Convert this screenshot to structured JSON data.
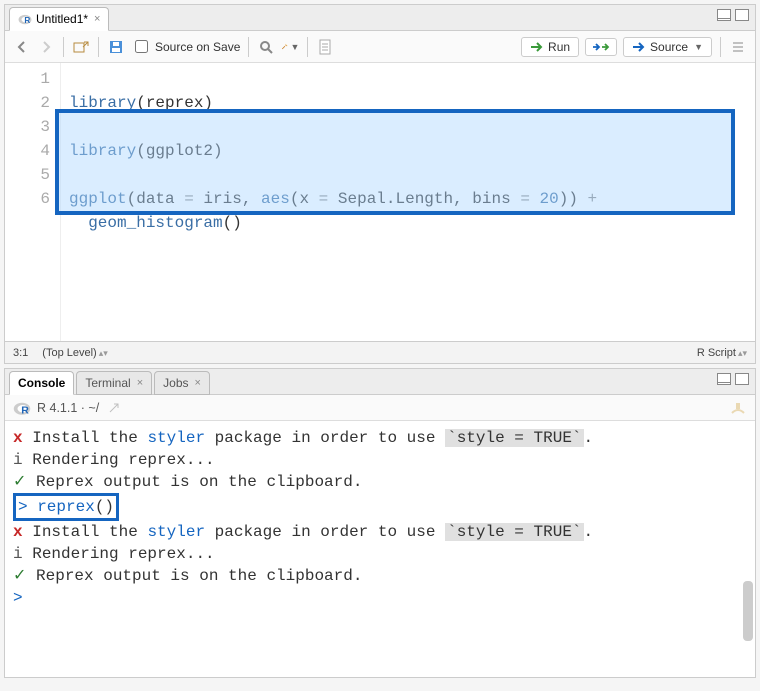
{
  "editor": {
    "tab_title": "Untitled1*",
    "toolbar": {
      "source_on_save": "Source on Save",
      "run": "Run",
      "source": "Source"
    },
    "lines": [
      {
        "n": "1",
        "text": "library(reprex)"
      },
      {
        "n": "2",
        "text": ""
      },
      {
        "n": "3",
        "text": "library(ggplot2)"
      },
      {
        "n": "4",
        "text": ""
      },
      {
        "n": "5",
        "text": "ggplot(data = iris, aes(x = Sepal.Length, bins = 20)) +"
      },
      {
        "n": "6",
        "text": "  geom_histogram()"
      }
    ],
    "status": {
      "pos": "3:1",
      "scope": "(Top Level)",
      "lang": "R Script"
    }
  },
  "console": {
    "tabs": {
      "console": "Console",
      "terminal": "Terminal",
      "jobs": "Jobs"
    },
    "header": "R 4.1.1 · ~/",
    "lines": [
      {
        "pre": "x",
        "cls": "con-x",
        "txt": "Install the ",
        "blue": "styler",
        "rest": " package in order to use ",
        "code": "`style = TRUE`",
        "tail": "."
      },
      {
        "pre": "i",
        "cls": "con-i",
        "txt": "Rendering reprex..."
      },
      {
        "pre": "✓",
        "cls": "con-ok",
        "txt": "Reprex output is on the clipboard."
      },
      {
        "prompt": "> ",
        "reprex": "reprex()"
      },
      {
        "pre": "x",
        "cls": "con-x",
        "txt": "Install the ",
        "blue": "styler",
        "rest": " package in order to use ",
        "code": "`style = TRUE`",
        "tail": "."
      },
      {
        "pre": "i",
        "cls": "con-i",
        "txt": "Rendering reprex..."
      },
      {
        "pre": "✓",
        "cls": "con-ok",
        "txt": "Reprex output is on the clipboard."
      },
      {
        "prompt": "> "
      }
    ]
  }
}
